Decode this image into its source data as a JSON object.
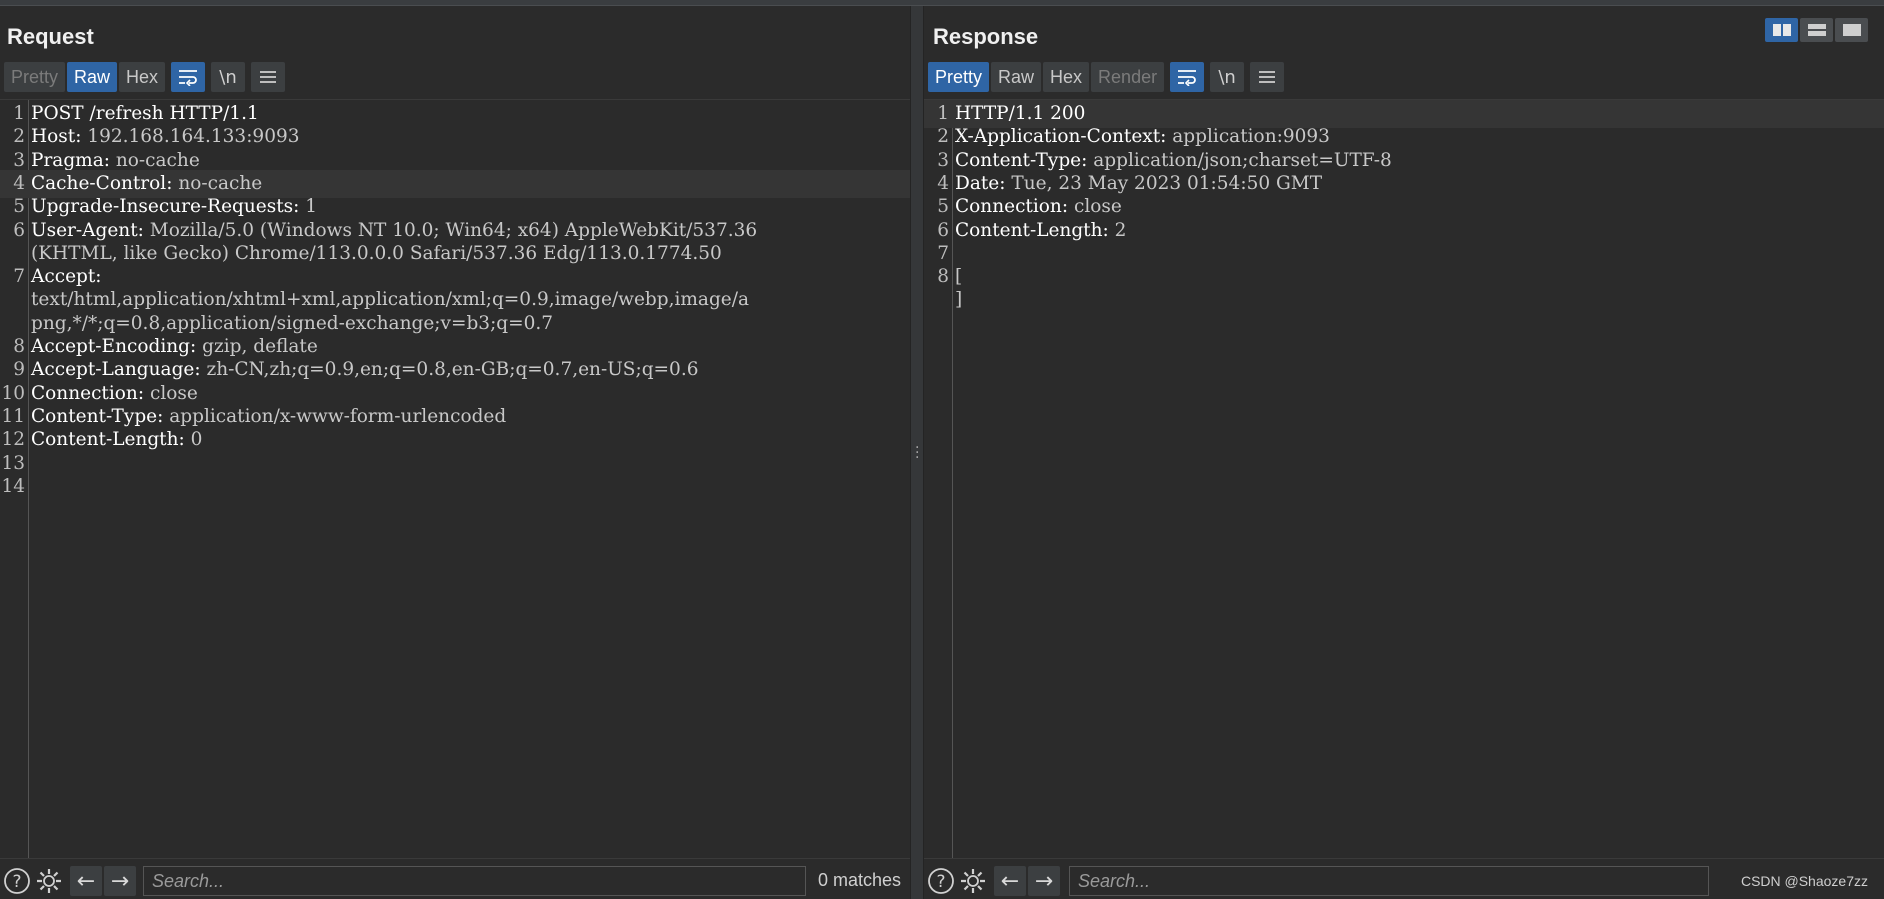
{
  "request": {
    "title": "Request",
    "tabs": [
      {
        "label": "Pretty",
        "state": "muted"
      },
      {
        "label": "Raw",
        "state": "active"
      },
      {
        "label": "Hex",
        "state": "normal"
      }
    ],
    "toolbar": {
      "wrap_icon": "wrap-lines-icon",
      "newline_label": "\\n",
      "menu_icon": "menu-icon"
    },
    "lines": [
      {
        "n": "1",
        "key": "POST /refresh HTTP/1.1",
        "val": ""
      },
      {
        "n": "2",
        "key": "Host:",
        "val": " 192.168.164.133:9093"
      },
      {
        "n": "3",
        "key": "Pragma:",
        "val": " no-cache"
      },
      {
        "n": "4",
        "key": "Cache-Control:",
        "val": " no-cache"
      },
      {
        "n": "5",
        "key": "Upgrade-Insecure-Requests:",
        "val": " 1"
      },
      {
        "n": "6",
        "key": "User-Agent:",
        "val": " Mozilla/5.0 (Windows NT 10.0; Win64; x64) AppleWebKit/537.36"
      },
      {
        "n": "",
        "key": "",
        "val": "(KHTML, like Gecko) Chrome/113.0.0.0 Safari/537.36 Edg/113.0.1774.50"
      },
      {
        "n": "7",
        "key": "Accept:",
        "val": ""
      },
      {
        "n": "",
        "key": "",
        "val": "text/html,application/xhtml+xml,application/xml;q=0.9,image/webp,image/a"
      },
      {
        "n": "",
        "key": "",
        "val": "png,*/*;q=0.8,application/signed-exchange;v=b3;q=0.7"
      },
      {
        "n": "8",
        "key": "Accept-Encoding:",
        "val": " gzip, deflate"
      },
      {
        "n": "9",
        "key": "Accept-Language:",
        "val": " zh-CN,zh;q=0.9,en;q=0.8,en-GB;q=0.7,en-US;q=0.6"
      },
      {
        "n": "10",
        "key": "Connection:",
        "val": " close"
      },
      {
        "n": "11",
        "key": "Content-Type:",
        "val": " application/x-www-form-urlencoded"
      },
      {
        "n": "12",
        "key": "Content-Length:",
        "val": " 0"
      },
      {
        "n": "13",
        "key": "",
        "val": ""
      },
      {
        "n": "14",
        "key": "",
        "val": ""
      }
    ],
    "footer": {
      "search_placeholder": "Search...",
      "matches": "0 matches"
    }
  },
  "response": {
    "title": "Response",
    "tabs": [
      {
        "label": "Pretty",
        "state": "active"
      },
      {
        "label": "Raw",
        "state": "normal"
      },
      {
        "label": "Hex",
        "state": "normal"
      },
      {
        "label": "Render",
        "state": "muted"
      }
    ],
    "toolbar": {
      "wrap_icon": "wrap-lines-icon",
      "newline_label": "\\n",
      "menu_icon": "menu-icon"
    },
    "lines": [
      {
        "n": "1",
        "key": "HTTP/1.1 200",
        "val": ""
      },
      {
        "n": "2",
        "key": "X-Application-Context:",
        "val": " application:9093"
      },
      {
        "n": "3",
        "key": "Content-Type:",
        "val": " application/json;charset=UTF-8"
      },
      {
        "n": "4",
        "key": "Date:",
        "val": " Tue, 23 May 2023 01:54:50 GMT"
      },
      {
        "n": "5",
        "key": "Connection:",
        "val": " close"
      },
      {
        "n": "6",
        "key": "Content-Length:",
        "val": " 2"
      },
      {
        "n": "7",
        "key": "",
        "val": ""
      },
      {
        "n": "8",
        "key": "",
        "val": "["
      },
      {
        "n": "",
        "key": "",
        "val": "]"
      }
    ],
    "footer": {
      "search_placeholder": "Search..."
    }
  },
  "view_buttons": [
    {
      "name": "side-by-side-view-icon",
      "state": "active"
    },
    {
      "name": "top-bottom-view-icon",
      "state": "normal"
    },
    {
      "name": "single-view-icon",
      "state": "normal"
    }
  ],
  "watermark": "CSDN @Shaoze7zz"
}
